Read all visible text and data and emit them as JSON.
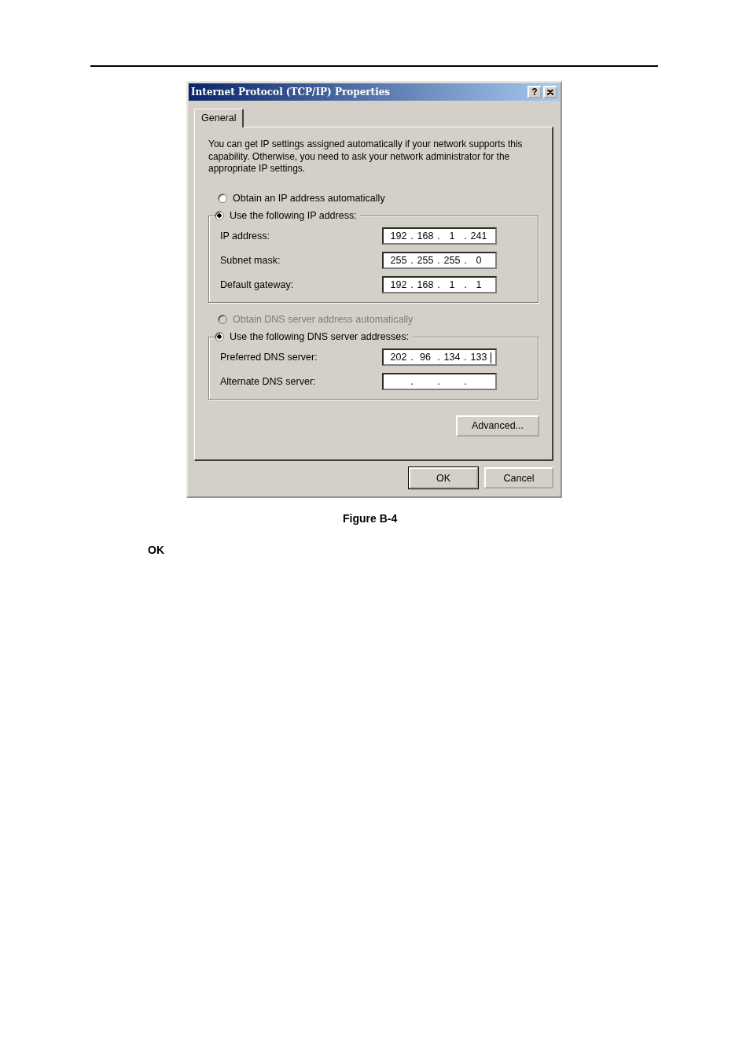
{
  "page": {
    "caption": "Figure B-4",
    "note": "OK"
  },
  "dialog": {
    "title": "Internet Protocol (TCP/IP) Properties",
    "help_label": "?",
    "tabs": [
      {
        "label": "General",
        "selected": true
      }
    ],
    "description": "You can get IP settings assigned automatically if your network supports this capability. Otherwise, you need to ask your network administrator for the appropriate IP settings.",
    "octet_separator": ".",
    "ip_options": [
      {
        "label": "Obtain an IP address automatically",
        "selected": false,
        "disabled": false
      },
      {
        "label": "Use the following IP address:",
        "selected": true,
        "disabled": false
      }
    ],
    "ip_fields": [
      {
        "label": "IP address:",
        "octets": [
          "192",
          "168",
          "1",
          "241"
        ],
        "focused": false
      },
      {
        "label": "Subnet mask:",
        "octets": [
          "255",
          "255",
          "255",
          "0"
        ],
        "focused": false
      },
      {
        "label": "Default gateway:",
        "octets": [
          "192",
          "168",
          "1",
          "1"
        ],
        "focused": false
      }
    ],
    "dns_options": [
      {
        "label": "Obtain DNS server address automatically",
        "selected": false,
        "disabled": true
      },
      {
        "label": "Use the following DNS server addresses:",
        "selected": true,
        "disabled": false
      }
    ],
    "dns_fields": [
      {
        "label": "Preferred DNS server:",
        "octets": [
          "202",
          "96",
          "134",
          "133"
        ],
        "focused": true
      },
      {
        "label": "Alternate DNS server:",
        "focused": false
      }
    ],
    "advanced_button": "Advanced...",
    "buttons": [
      {
        "label": "OK",
        "default": true
      },
      {
        "label": "Cancel",
        "default": false
      }
    ]
  }
}
